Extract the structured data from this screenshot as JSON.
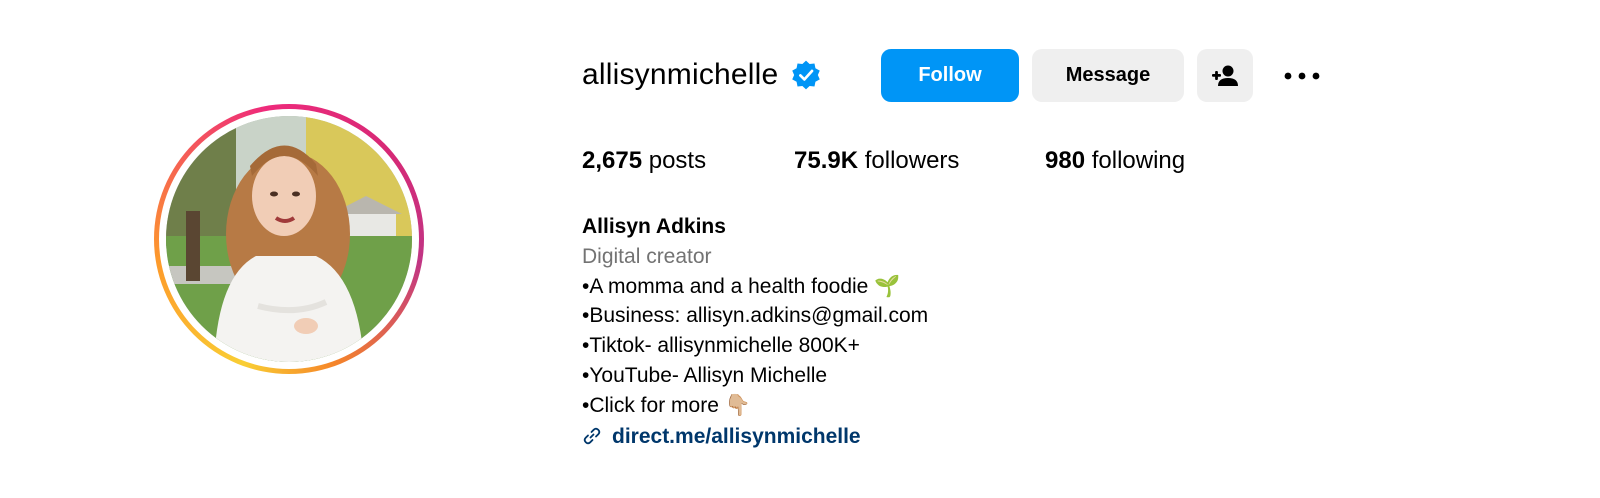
{
  "profile": {
    "username": "allisynmichelle",
    "verified": true,
    "actions": {
      "follow_label": "Follow",
      "message_label": "Message",
      "add_user_icon": "person-add-icon",
      "more_icon": "more-options-icon"
    },
    "stats": {
      "posts": {
        "value": "2,675",
        "label": "posts"
      },
      "followers": {
        "value": "75.9K",
        "label": "followers"
      },
      "following": {
        "value": "980",
        "label": "following"
      }
    },
    "full_name": "Allisyn Adkins",
    "category": "Digital creator",
    "bio_lines": [
      "•A momma and a health foodie 🌱",
      "•Business: allisyn.adkins@gmail.com",
      "•Tiktok- allisynmichelle 800K+",
      "•YouTube- Allisyn Michelle",
      "•Click for more 👇🏼"
    ],
    "link": "direct.me/allisynmichelle"
  },
  "colors": {
    "follow_button": "#0095f6",
    "secondary_button": "#efefef",
    "verified_badge": "#0095f6",
    "category_text": "#737373",
    "link_text": "#00376b"
  }
}
